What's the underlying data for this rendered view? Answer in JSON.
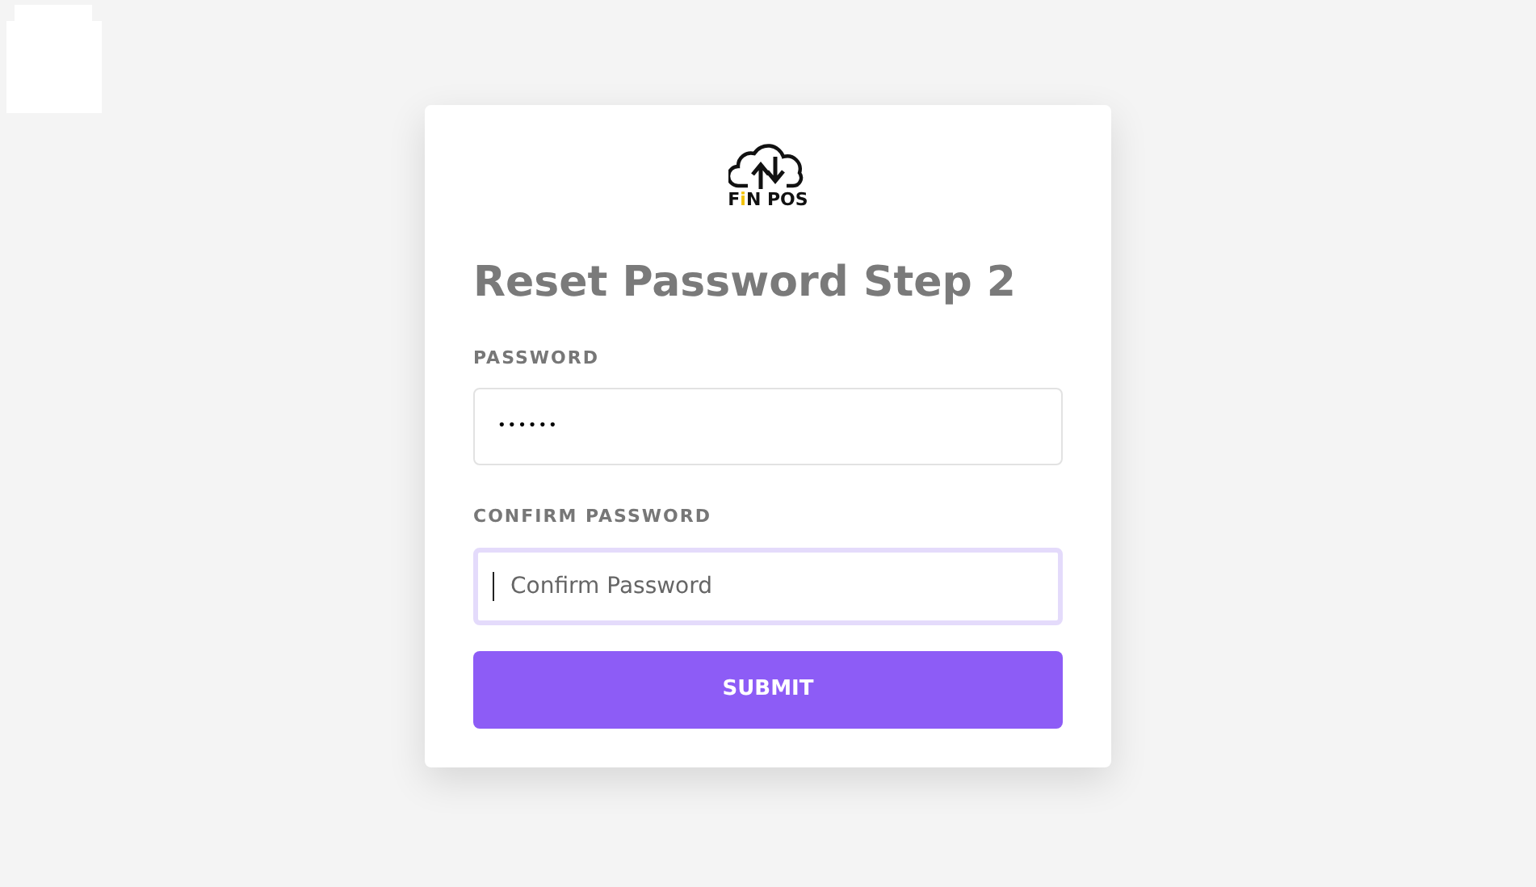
{
  "logo": {
    "segments": [
      {
        "text": "F",
        "color": "#111111"
      },
      {
        "text": "i",
        "color": "#f2c200"
      },
      {
        "text": "N POS",
        "color": "#111111"
      }
    ]
  },
  "title": "Reset Password Step 2",
  "fields": [
    {
      "label": "PASSWORD",
      "value": "••••••",
      "focused": false
    },
    {
      "label": "CONFIRM PASSWORD",
      "placeholder": "Confirm Password",
      "focused": true
    }
  ],
  "submit": "SUBMIT"
}
